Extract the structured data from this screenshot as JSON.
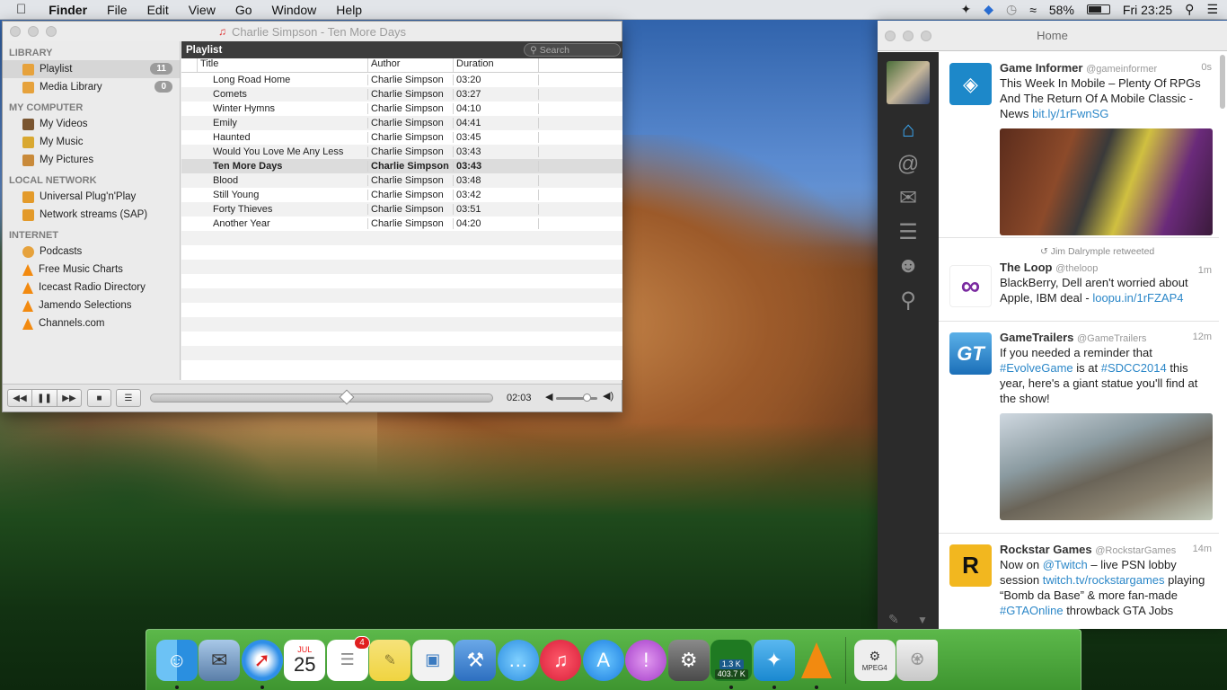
{
  "menubar": {
    "apple": "",
    "app": "Finder",
    "items": [
      "File",
      "Edit",
      "View",
      "Go",
      "Window",
      "Help"
    ],
    "battery": "58%",
    "clock": "Fri 23:25"
  },
  "vlc": {
    "title": "Charlie Simpson - Ten More Days",
    "sections": {
      "library": "LIBRARY",
      "computer": "MY COMPUTER",
      "network": "LOCAL NETWORK",
      "internet": "INTERNET"
    },
    "library_items": [
      {
        "label": "Playlist",
        "badge": "11"
      },
      {
        "label": "Media Library",
        "badge": "0"
      }
    ],
    "computer_items": [
      "My Videos",
      "My Music",
      "My Pictures"
    ],
    "network_items": [
      "Universal Plug'n'Play",
      "Network streams (SAP)"
    ],
    "internet_items": [
      "Podcasts",
      "Free Music Charts",
      "Icecast Radio Directory",
      "Jamendo Selections",
      "Channels.com"
    ],
    "playlist_header": "Playlist",
    "search_placeholder": "Search",
    "columns": [
      "Title",
      "Author",
      "Duration"
    ],
    "tracks": [
      {
        "title": "Long Road Home",
        "author": "Charlie Simpson",
        "duration": "03:20"
      },
      {
        "title": "Comets",
        "author": "Charlie Simpson",
        "duration": "03:27"
      },
      {
        "title": "Winter Hymns",
        "author": "Charlie Simpson",
        "duration": "04:10"
      },
      {
        "title": "Emily",
        "author": "Charlie Simpson",
        "duration": "04:41"
      },
      {
        "title": "Haunted",
        "author": "Charlie Simpson",
        "duration": "03:45"
      },
      {
        "title": "Would You Love Me Any Less",
        "author": "Charlie Simpson",
        "duration": "03:43"
      },
      {
        "title": "Ten More Days",
        "author": "Charlie Simpson",
        "duration": "03:43"
      },
      {
        "title": "Blood",
        "author": "Charlie Simpson",
        "duration": "03:48"
      },
      {
        "title": "Still Young",
        "author": "Charlie Simpson",
        "duration": "03:42"
      },
      {
        "title": "Forty Thieves",
        "author": "Charlie Simpson",
        "duration": "03:51"
      },
      {
        "title": "Another Year",
        "author": "Charlie Simpson",
        "duration": "04:20"
      }
    ],
    "elapsed": "02:03",
    "progress_fraction": 0.57,
    "volume_fraction": 0.8
  },
  "twitter": {
    "title": "Home",
    "tweets": [
      {
        "name": "Game Informer",
        "handle": "@gameinformer",
        "time": "0s",
        "text": "This Week In Mobile – Plenty Of RPGs And The Return Of A Mobile Classic - News ",
        "link": "bit.ly/1rFwnSG"
      },
      {
        "retweet": "Jim Dalrymple retweeted",
        "name": "The Loop",
        "handle": "@theloop",
        "time": "1m",
        "text": "BlackBerry, Dell aren't worried about Apple, IBM deal - ",
        "link": "loopu.in/1rFZAP4"
      },
      {
        "name": "GameTrailers",
        "handle": "@GameTrailers",
        "time": "12m",
        "t1": "If you needed a reminder that ",
        "h1": "#EvolveGame",
        "t2": " is at ",
        "h2": "#SDCC2014",
        "t3": " this year, here's a giant statue you'll find at the show!"
      },
      {
        "name": "Rockstar Games",
        "handle": "@RockstarGames",
        "time": "14m",
        "t1": "Now on ",
        "m1": "@Twitch",
        "t2": " – live PSN lobby session ",
        "l1": "twitch.tv/rockstargames",
        "t3": " playing “Bomb da Base” & more fan-made ",
        "h1": "#GTAOnline",
        "t4": " throwback GTA Jobs"
      }
    ]
  },
  "dock": {
    "calendar_month": "JUL",
    "calendar_day": "25",
    "reminders_badge": "4",
    "utorrent_up": "1.3 K",
    "utorrent_down": "403.7 K",
    "mpeg_label": "MPEG4"
  }
}
